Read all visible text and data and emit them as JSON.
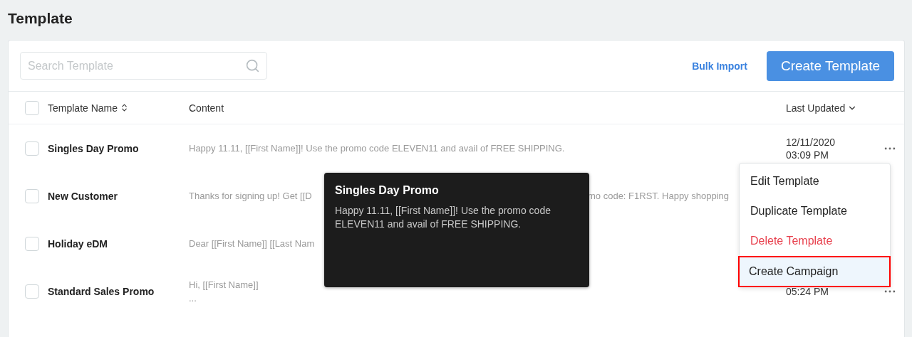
{
  "page": {
    "title": "Template"
  },
  "toolbar": {
    "search": {
      "placeholder": "Search Template"
    },
    "bulk_import": "Bulk Import",
    "create_button": "Create Template"
  },
  "table": {
    "select_all": {
      "checked": false
    },
    "columns": [
      {
        "label": "Template Name",
        "kind": "sortable"
      },
      {
        "label": "Content",
        "kind": "plain"
      },
      {
        "label": "Last Updated",
        "kind": "descending"
      }
    ],
    "rows": [
      {
        "name": "Singles Day Promo",
        "checked": false,
        "content": {
          "kind": "split",
          "parts": [
            "Happy 11.11, [[First Name]]! Use the promo code ELEVEN11 and avail of FREE SHIPPING."
          ]
        },
        "updated": [
          "12/11/2020",
          "03:09 PM"
        ],
        "more_button": true
      },
      {
        "name": "New Customer",
        "checked": false,
        "content": {
          "kind": "split",
          "parts": [
            "Thanks for signing up! Get [[D",
            "mo code: F1RST. Happy shopping"
          ]
        },
        "more_button": false
      },
      {
        "name": "Holiday eDM",
        "checked": false,
        "content": {
          "kind": "split",
          "parts": [
            "Dear [[First Name]] [[Last Nam"
          ]
        },
        "more_button": false
      },
      {
        "name": "Standard Sales Promo",
        "checked": false,
        "content": {
          "kind": "lines",
          "parts": [
            "Hi, [[First Name]]",
            "..."
          ]
        },
        "updated": [
          "05:24 PM"
        ],
        "more_button": true
      }
    ]
  },
  "tooltip": {
    "title": "Singles Day Promo",
    "text": "Happy 11.11, [[First Name]]! Use the promo code ELEVEN11 and avail of FREE SHIPPING."
  },
  "menu": {
    "items": [
      {
        "label": "Edit Template",
        "danger": false,
        "selected": false
      },
      {
        "label": "Duplicate Template",
        "danger": false,
        "selected": false
      },
      {
        "label": "Delete Template",
        "danger": true,
        "selected": false
      },
      {
        "label": "Create Campaign",
        "danger": false,
        "selected": true
      }
    ]
  }
}
